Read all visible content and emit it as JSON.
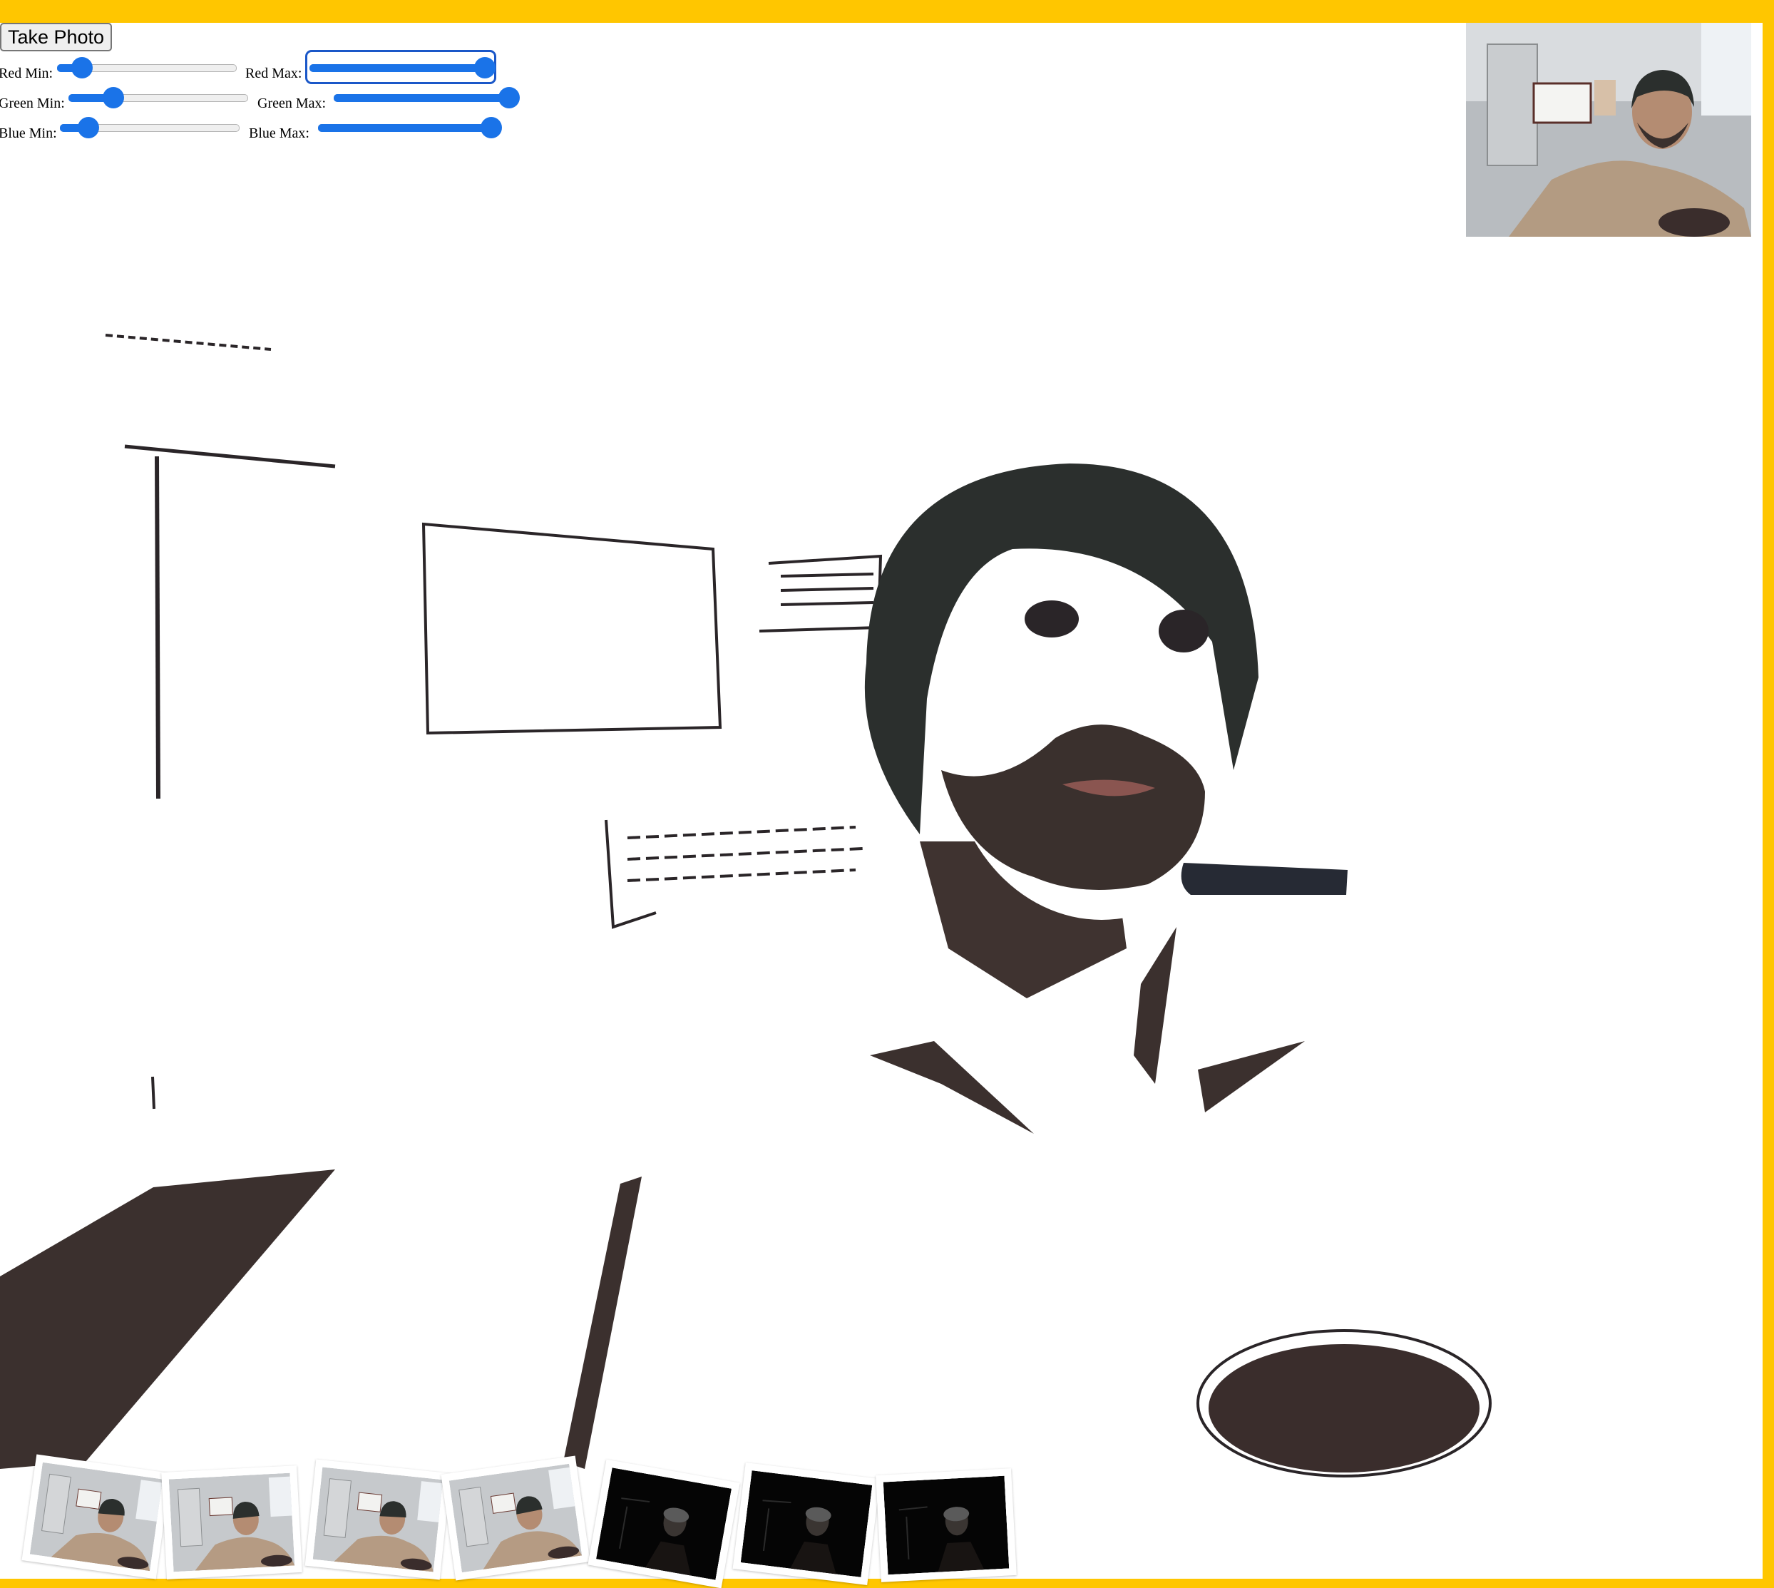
{
  "controls": {
    "take_photo_label": "Take Photo",
    "red_min_label": "Red Min:",
    "red_max_label": "Red Max:",
    "green_min_label": "Green Min:",
    "green_max_label": "Green Max:",
    "blue_min_label": "Blue Min:",
    "blue_max_label": "Blue Max:",
    "red_min_value": 0.14,
    "red_max_value": 0.96,
    "green_min_value": 0.25,
    "green_max_value": 0.96,
    "blue_min_value": 0.16,
    "blue_max_value": 0.95
  },
  "colors": {
    "page_background": "#ffc600",
    "slider_accent": "#1a73e8",
    "filtered_pixels": "#3a2f2d",
    "beanie": "#2b2f2d"
  },
  "thumbnails": [
    {
      "style": "normal"
    },
    {
      "style": "normal"
    },
    {
      "style": "normal"
    },
    {
      "style": "normal"
    },
    {
      "style": "dark"
    },
    {
      "style": "dark"
    },
    {
      "style": "dark"
    }
  ]
}
